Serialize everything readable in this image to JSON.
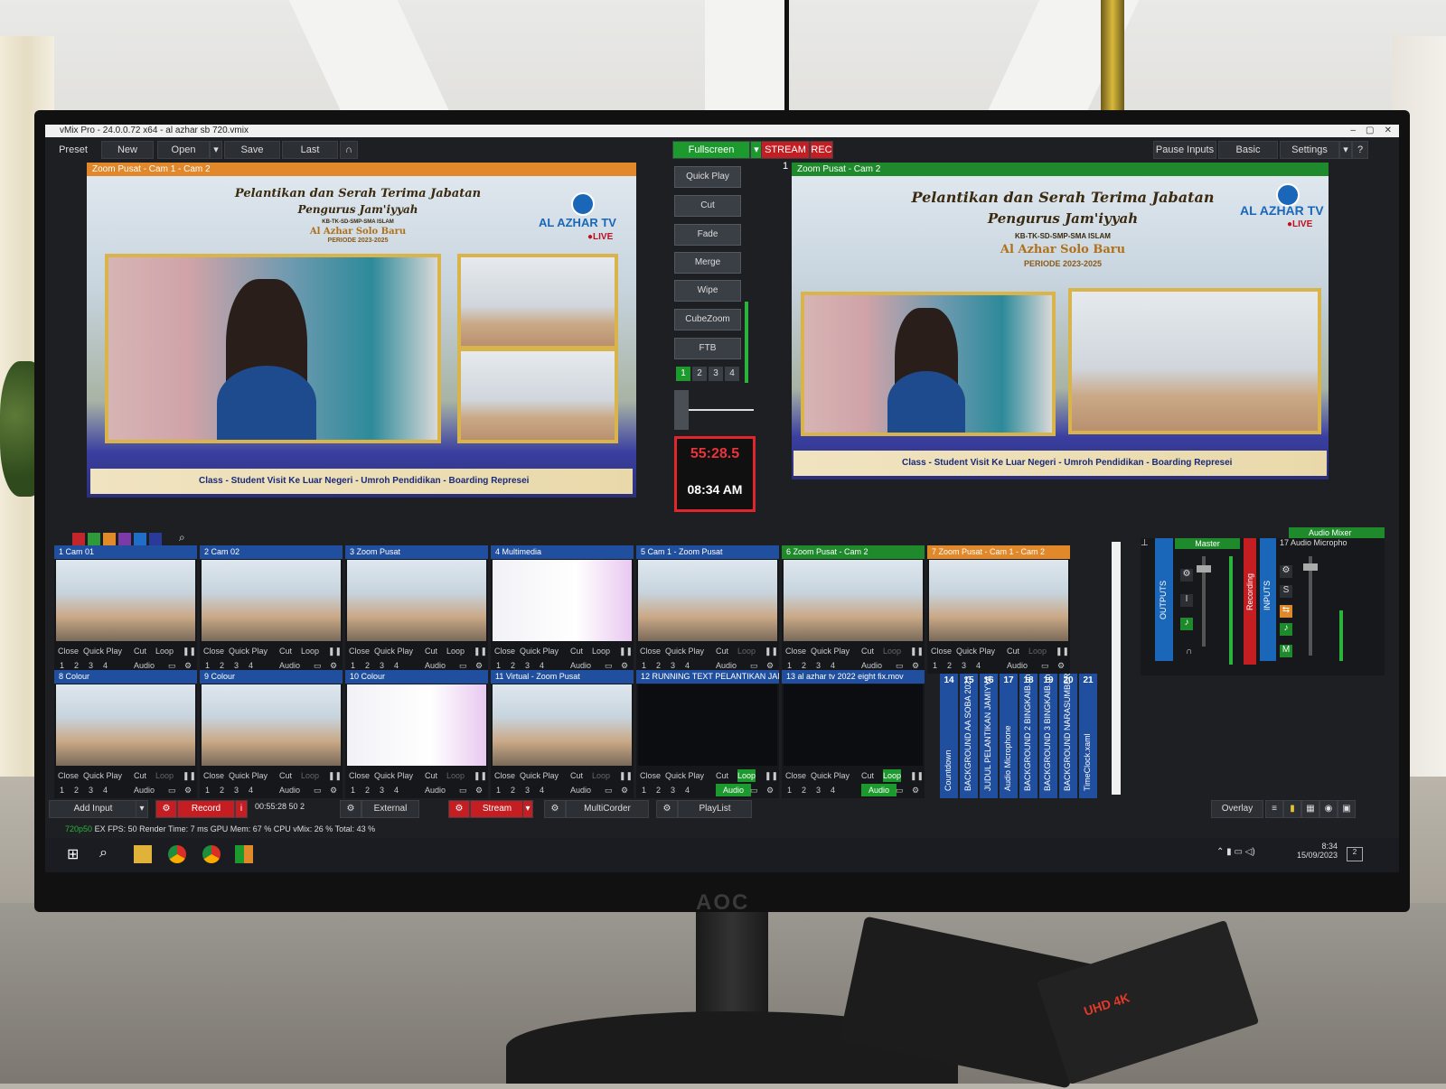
{
  "window": {
    "title": "vMix Pro - 24.0.0.72 x64 - al azhar sb 720.vmix",
    "controls": [
      "–",
      "▢",
      "✕"
    ]
  },
  "menu": {
    "preset": "Preset",
    "new": "New",
    "open": "Open",
    "save": "Save",
    "last": "Last",
    "fullscreen": "Fullscreen",
    "stream_badge": "STREAM 1",
    "rec_badge": "REC",
    "pause_inputs": "Pause Inputs",
    "basic": "Basic",
    "settings": "Settings",
    "help": "?"
  },
  "preview": {
    "title": "Zoom Pusat - Cam 1 - Cam 2",
    "header_line1": "Pelantikan dan Serah Terima Jabatan",
    "header_line2": "Pengurus Jam'iyyah",
    "header_line3": "KB-TK-SD-SMP-SMA ISLAM",
    "header_line4": "Al Azhar Solo Baru",
    "header_line5": "PERIODE 2023-2025",
    "tv_name": "AL AZHAR TV",
    "live": "●LIVE",
    "ticker": "Class - Student Visit Ke Luar Negeri - Umroh Pendidikan - Boarding Represei"
  },
  "output": {
    "title": "Zoom Pusat - Cam 2",
    "header_line1": "Pelantikan dan Serah Terima Jabatan",
    "header_line2": "Pengurus Jam'iyyah",
    "header_line3": "KB-TK-SD-SMP-SMA ISLAM",
    "header_line4": "Al Azhar Solo Baru",
    "header_line5": "PERIODE 2023-2025",
    "tv_name": "AL AZHAR TV",
    "live": "●LIVE",
    "ticker": "Class - Student Visit Ke Luar Negeri - Umroh Pendidikan - Boarding Represei"
  },
  "transitions": {
    "quick_play": "Quick Play",
    "cut": "Cut",
    "fade": "Fade",
    "merge": "Merge",
    "wipe": "Wipe",
    "cubezoom": "CubeZoom",
    "ftb": "FTB",
    "slots": [
      "1",
      "2",
      "3",
      "4"
    ]
  },
  "clock": {
    "countdown": "55:28.5",
    "time": "08:34 AM"
  },
  "swatches": [
    "#c0262c",
    "#2e9a3a",
    "#e08a2a",
    "#7a3aa8",
    "#1f6fc8",
    "#2a3a9a"
  ],
  "tiles": [
    {
      "num": "1",
      "name": "Cam 01",
      "color": "blue",
      "loop_active": true
    },
    {
      "num": "2",
      "name": "Cam 02",
      "color": "blue",
      "loop_active": true
    },
    {
      "num": "3",
      "name": "Zoom Pusat",
      "color": "blue",
      "loop_active": true
    },
    {
      "num": "4",
      "name": "Multimedia",
      "color": "blue",
      "loop_active": true
    },
    {
      "num": "5",
      "name": "Cam 1 - Zoom Pusat",
      "color": "blue",
      "loop_active": false
    },
    {
      "num": "6",
      "name": "Zoom Pusat - Cam 2",
      "color": "green",
      "loop_active": false
    },
    {
      "num": "7",
      "name": "Zoom Pusat - Cam 1 - Cam 2",
      "color": "orange",
      "loop_active": false
    },
    {
      "num": "8",
      "name": "Colour",
      "color": "blue",
      "loop_active": false
    },
    {
      "num": "9",
      "name": "Colour",
      "color": "blue",
      "loop_active": false
    },
    {
      "num": "10",
      "name": "Colour",
      "color": "blue",
      "loop_active": false
    },
    {
      "num": "11",
      "name": "Virtual - Zoom Pusat",
      "color": "blue",
      "loop_active": false
    },
    {
      "num": "12",
      "name": "RUNNING TEXT PELANTIKAN JAM",
      "color": "blue",
      "loop_active": true
    },
    {
      "num": "13",
      "name": "al azhar tv 2022 eight fix.mov",
      "color": "blue",
      "loop_active": true
    }
  ],
  "tile_labels": {
    "close": "Close",
    "quick_play": "Quick Play",
    "cut": "Cut",
    "loop": "Loop",
    "audio": "Audio",
    "pause": "❚❚",
    "n1": "1",
    "n2": "2",
    "n3": "3",
    "n4": "4"
  },
  "vertical_inputs": [
    {
      "num": "14",
      "name": "Countdown"
    },
    {
      "num": "15",
      "name": "BACKGROUND AA SOBA 2023"
    },
    {
      "num": "16",
      "name": "JUDUL PELANTIKAN JAMIYYA"
    },
    {
      "num": "17",
      "name": "Audio Microphone"
    },
    {
      "num": "18",
      "name": "BACKGROUND 2 BINGKAIB.pn"
    },
    {
      "num": "19",
      "name": "BACKGROUND 3 BINGKAIB.pn"
    },
    {
      "num": "20",
      "name": "BACKGROUND NARASUMBER"
    },
    {
      "num": "21",
      "name": "TimeClock.xaml"
    }
  ],
  "audio": {
    "mixer_label": "Audio Mixer",
    "outputs": "OUTPUTS",
    "master": "Master",
    "recording": "Recording",
    "inputs": "INPUTS",
    "input17": "17 Audio Micropho",
    "s": "S",
    "m": "M",
    "i": "I"
  },
  "bottom": {
    "add_input": "Add Input",
    "record": "Record",
    "rec_time": "00:55:28 50 2",
    "external": "External",
    "stream": "Stream",
    "multicorder": "MultiCorder",
    "playlist": "PlayList",
    "overlay": "Overlay"
  },
  "status": {
    "resolution": "720p50",
    "fps_label": "EX FPS:",
    "fps": "50",
    "render_label": "Render Time:",
    "render": "7 ms",
    "gpu_label": "GPU Mem:",
    "gpu": "67 %",
    "cpu_label": "CPU vMix:",
    "cpu": "26 %",
    "total_label": "Total:",
    "total": "43 %"
  },
  "taskbar": {
    "time": "8:34",
    "date": "15/09/2023",
    "notif": "2"
  },
  "physical": {
    "monitor_brand": "AOC",
    "box_label": "UHD 4K"
  }
}
